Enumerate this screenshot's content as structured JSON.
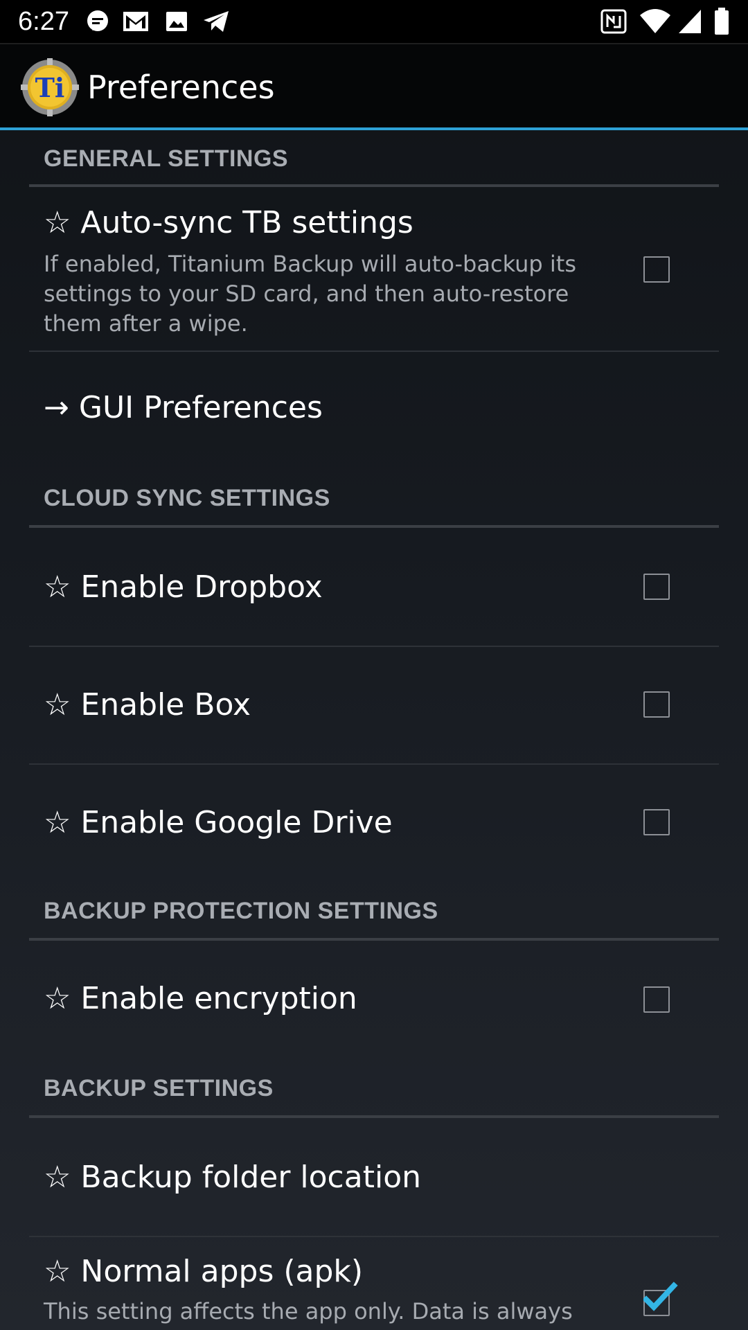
{
  "status_bar": {
    "time": "6:27",
    "left_icons": [
      "message-bubble-icon",
      "gmail-icon",
      "image-icon",
      "telegram-icon"
    ],
    "right_icons": [
      "nfc-icon",
      "wifi-icon",
      "signal-icon",
      "battery-icon"
    ]
  },
  "app_bar": {
    "title": "Preferences",
    "logo": "titanium-backup-logo",
    "accent_color": "#2ea1d6"
  },
  "sections": {
    "general": {
      "header": "GENERAL SETTINGS",
      "auto_sync": {
        "title": "☆ Auto-sync TB settings",
        "summary_line1": "If enabled, Titanium Backup will auto-backup its",
        "summary_line2": "settings to your SD card, and then auto-restore",
        "summary_line3": "them after a wipe.",
        "checked": false
      },
      "gui_preferences": {
        "title": "→ GUI Preferences"
      }
    },
    "cloud_sync": {
      "header": "CLOUD SYNC SETTINGS",
      "dropbox": {
        "title": "☆ Enable Dropbox",
        "checked": false
      },
      "box": {
        "title": "☆ Enable Box",
        "checked": false
      },
      "google_drive": {
        "title": "☆ Enable Google Drive",
        "checked": false
      }
    },
    "backup_protection": {
      "header": "BACKUP PROTECTION SETTINGS",
      "encryption": {
        "title": "☆ Enable encryption",
        "checked": false
      }
    },
    "backup": {
      "header": "BACKUP SETTINGS",
      "folder_location": {
        "title": "☆ Backup folder location"
      },
      "normal_apps": {
        "title": "☆ Normal apps (apk)",
        "summary_line1": "This setting affects the app only. Data is always",
        "checked": true
      }
    }
  }
}
